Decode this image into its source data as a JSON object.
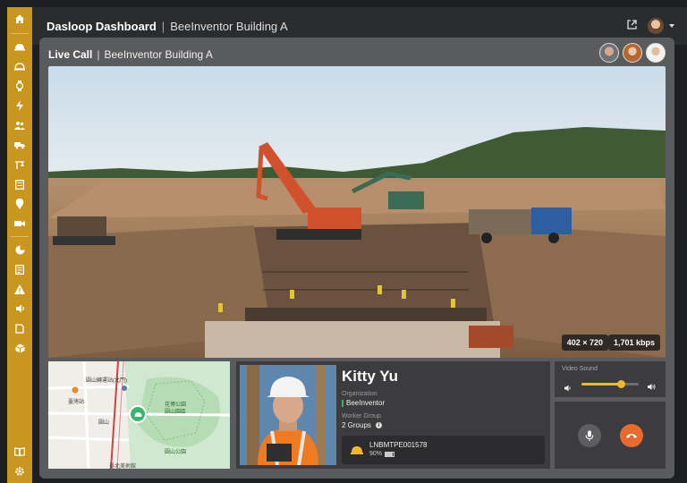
{
  "topbar": {
    "title": "Dasloop Dashboard",
    "subtitle": "BeeInventor Building A"
  },
  "sidebar": {
    "items": [
      "home-icon",
      "helmet-icon",
      "helmet-alert-icon",
      "watch-icon",
      "power-icon",
      "group-icon",
      "truck-icon",
      "crane-icon",
      "doc-icon",
      "pin-icon",
      "camera-icon",
      "pie-icon",
      "report-icon",
      "alert-icon",
      "broadcast-icon",
      "clipboard-icon",
      "cube-icon",
      "book-icon",
      "settings-icon"
    ]
  },
  "call": {
    "title": "Live Call",
    "subtitle": "BeeInventor Building A",
    "resolution": "402 × 720",
    "bitrate": "1,701 kbps"
  },
  "map": {
    "labels": [
      "圓山轉運站(北門)",
      "臺灣站",
      "圓山",
      "花博公園",
      "圓山園區",
      "圓山公園",
      "臺北美術館"
    ]
  },
  "worker": {
    "name": "Kitty Yu",
    "org_label": "Organization",
    "org_value": "BeeInventor",
    "group_label": "Worker Group",
    "group_value": "2 Groups",
    "device_id": "LNBMTPE001578",
    "battery": "90%"
  },
  "sound": {
    "label": "Video Sound",
    "level": 0.7
  },
  "colors": {
    "accent": "#c9961f",
    "end_call": "#e86a2c",
    "org_green": "#3cb371"
  }
}
